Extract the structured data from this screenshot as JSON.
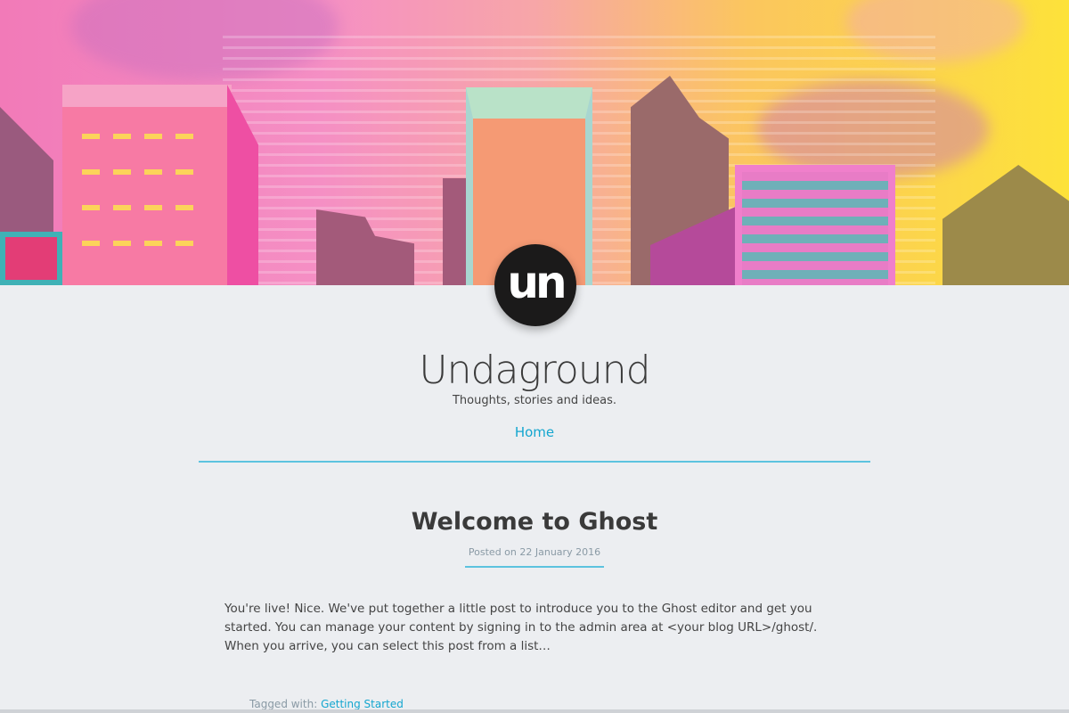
{
  "blog": {
    "title": "Undaground",
    "tagline": "Thoughts, stories and ideas.",
    "logo_text": "un"
  },
  "nav": {
    "home": "Home"
  },
  "post": {
    "title": "Welcome to Ghost",
    "date": "Posted on 22 January 2016",
    "excerpt": "You're live! Nice. We've put together a little post to introduce you to the Ghost editor and get you started. You can manage your content by signing in to the admin area at <your blog URL>/ghost/. When you arrive, you can select this post from a list…",
    "tagged_label": "Tagged with:",
    "tag": "Getting Started"
  },
  "colors": {
    "accent": "#14a6cf",
    "background": "#eceef1"
  }
}
